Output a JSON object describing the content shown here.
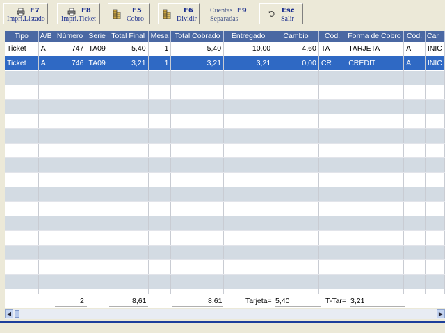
{
  "toolbar": {
    "buttons": [
      {
        "key": "F7",
        "label": "Impri.Listado",
        "icon": "printer-icon"
      },
      {
        "key": "F8",
        "label": "Impri.Ticket",
        "icon": "printer-icon"
      },
      {
        "key": "F5",
        "label": "Cobro",
        "icon": "coins-icon"
      },
      {
        "key": "F6",
        "label": "Dividir",
        "icon": "coins-icon"
      },
      {
        "key": "F9",
        "label_top": "Cuentas",
        "label": "Separadas"
      },
      {
        "key": "Esc",
        "label": "Salir",
        "icon": "undo-icon"
      }
    ]
  },
  "grid": {
    "columns": [
      "Tipo",
      "A/B",
      "Número",
      "Serie",
      "Total Final",
      "Mesa",
      "Total Cobrado",
      "Entregado",
      "Cambio",
      "Cód.",
      "Forma de Cobro",
      "Cód.",
      "Car"
    ],
    "rows": [
      [
        "Ticket",
        "A",
        "747",
        "TA09",
        "5,40",
        "1",
        "5,40",
        "10,00",
        "4,60",
        "TA",
        "TARJETA",
        "A",
        "INIC"
      ],
      [
        "Ticket",
        "A",
        "746",
        "TA09",
        "3,21",
        "1",
        "3,21",
        "3,21",
        "0,00",
        "CR",
        "CREDIT",
        "A",
        "INIC"
      ]
    ],
    "selected_row": 1
  },
  "totals": {
    "count": "2",
    "total_final": "8,61",
    "total_cobrado": "8,61",
    "tarjeta_label": "Tarjeta=",
    "tarjeta_value": "5,40",
    "ttar_label": "T-Tar=",
    "ttar_value": "3,21"
  },
  "colors": {
    "header_bg": "#4a68a3",
    "selected_bg": "#2f69c4",
    "alt_row": "#d3dbe3",
    "toolbar_text": "#1c2f8f"
  }
}
